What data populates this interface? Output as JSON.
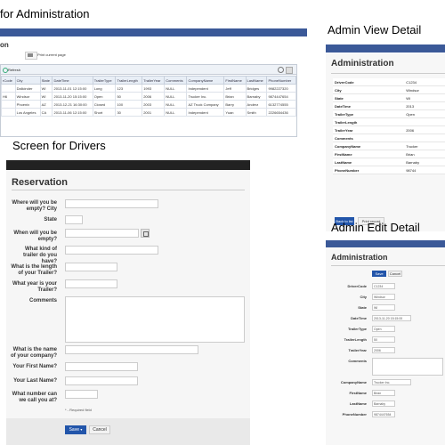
{
  "headings": {
    "admin": "for Administration",
    "view": "Admin View Detail",
    "drivers": "Screen for Drivers",
    "edit": "Admin Edit Detail"
  },
  "admin_grid": {
    "section_title": "on",
    "print_label": "Print current page",
    "refresh_label": "Refresh",
    "columns": [
      "rCode",
      "City",
      "State",
      "DateTime",
      "TrailerType",
      "TrailerLength",
      "TrailerYear",
      "Comments",
      "CompanyName",
      "FirstName",
      "LastName",
      "PhoneNumber"
    ],
    "rows": [
      [
        "",
        "Dallcinder",
        "WI",
        "2013-11-01 12:15:00",
        "Long",
        "123",
        "1993",
        "NULL",
        "Independent",
        "Jeff",
        "Bridges",
        "9982227320"
      ],
      [
        "H6",
        "Windsor",
        "WI",
        "2013-11-20 15:15:00",
        "Open",
        "50",
        "2006",
        "NULL",
        "Trucker Inc.",
        "Brian",
        "Barnaby",
        "9874447654"
      ],
      [
        "",
        "Phoenix",
        "AZ",
        "2013-12-21 16:30:00",
        "Closed",
        "100",
        "2003",
        "NULL",
        "AZ Truck Company",
        "Barry",
        "Anderz",
        "6132774555"
      ],
      [
        "",
        "Los Angeles",
        "CA",
        "2013-11-06 12:15:00",
        "Short",
        "30",
        "2001",
        "NULL",
        "Independent",
        "Yuan",
        "Smith",
        "2226654436"
      ]
    ]
  },
  "view_detail": {
    "section_title": "Administration",
    "fields": [
      "DriverCode",
      "City",
      "State",
      "DateTime",
      "TrailerType",
      "TrailerLength",
      "TrailerYear",
      "Comments",
      "CompanyName",
      "FirstName",
      "LastName",
      "PhoneNumber"
    ],
    "values": [
      "C1234",
      "Windsor",
      "WI",
      "2013",
      "Open",
      "",
      "2006",
      "",
      "Trucker",
      "Brian",
      "Barnaby",
      "98744"
    ],
    "back_label": "Back to list",
    "print_label": "Print record"
  },
  "reservation": {
    "title": "Reservation",
    "fields": {
      "city": "Where will you be empty? City",
      "state": "State",
      "when": "When will you be empty?",
      "kind": "What kind of trailer do you have?",
      "length": "What is the length of your Trailer?",
      "year": "What year is your Trailer?",
      "comments": "Comments",
      "company": "What is the name of your company?",
      "first": "Your First Name?",
      "last": "Your Last Name?",
      "phone": "What number can we call you at?"
    },
    "required_note": "* - Required field",
    "save_label": "Save",
    "cancel_label": "Cancel"
  },
  "edit_detail": {
    "section_title": "Administration",
    "save_label": "Save",
    "cancel_label": "Cancel",
    "fields": [
      "DriverCode",
      "City",
      "State",
      "DateTime",
      "TrailerType",
      "TrailerLength",
      "TrailerYear",
      "Comments",
      "CompanyName",
      "FirstName",
      "LastName",
      "PhoneNumber"
    ],
    "values": [
      "C1234",
      "Windsor",
      "WI",
      "2013-11-20 15:15:00",
      "Open",
      "50",
      "2006",
      "",
      "Trucker Inc.",
      "Brian",
      "Barnaby",
      "9874447654"
    ]
  },
  "icons": [
    "print-icon",
    "refresh-icon",
    "search-icon",
    "calendar-icon",
    "chevron-down-icon",
    "back-icon"
  ]
}
